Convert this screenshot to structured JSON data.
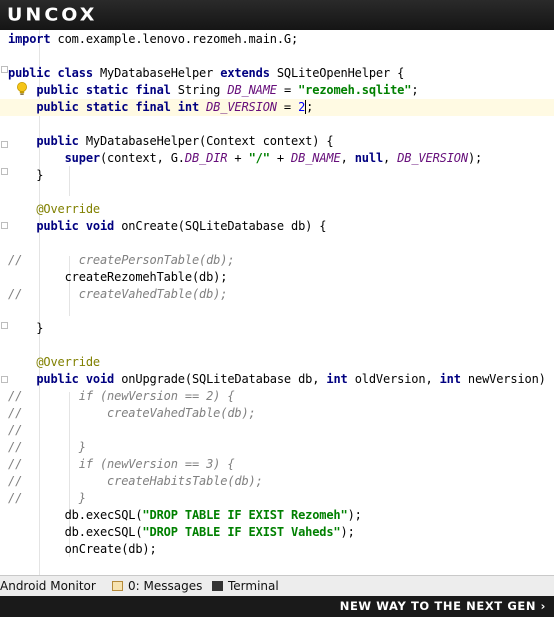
{
  "window": {
    "logo_text": "UNCOX",
    "tagline": "NEW WAY TO THE NEXT GEN ›"
  },
  "code": {
    "lines": [
      [
        [
          "kw",
          "import"
        ],
        [
          "t",
          " com.example.lenovo.rezomeh.main.G;"
        ]
      ],
      [],
      [
        [
          "kw",
          "public class"
        ],
        [
          "t",
          " MyDatabaseHelper "
        ],
        [
          "kw",
          "extends"
        ],
        [
          "t",
          " SQLiteOpenHelper {"
        ]
      ],
      [
        [
          "t",
          "    "
        ],
        [
          "kw",
          "public static final"
        ],
        [
          "t",
          " String "
        ],
        [
          "fld",
          "DB_NAME"
        ],
        [
          "t",
          " = "
        ],
        [
          "str",
          "\"rezomeh.sqlite\""
        ],
        [
          "t",
          ";"
        ]
      ],
      [
        [
          "t",
          "    "
        ],
        [
          "kw",
          "public static final int"
        ],
        [
          "t",
          " "
        ],
        [
          "fld",
          "DB_VERSION"
        ],
        [
          "t",
          " = "
        ],
        [
          "num",
          "2"
        ],
        [
          "cur",
          ""
        ],
        [
          "t",
          ";"
        ]
      ],
      [],
      [
        [
          "t",
          "    "
        ],
        [
          "kw",
          "public"
        ],
        [
          "t",
          " MyDatabaseHelper(Context context) {"
        ]
      ],
      [
        [
          "t",
          "        "
        ],
        [
          "kw",
          "super"
        ],
        [
          "t",
          "(context, G."
        ],
        [
          "fld",
          "DB_DIR"
        ],
        [
          "t",
          " + "
        ],
        [
          "str",
          "\"/\""
        ],
        [
          "t",
          " + "
        ],
        [
          "fld",
          "DB_NAME"
        ],
        [
          "t",
          ", "
        ],
        [
          "kw",
          "null"
        ],
        [
          "t",
          ", "
        ],
        [
          "fld",
          "DB_VERSION"
        ],
        [
          "t",
          ");"
        ]
      ],
      [
        [
          "t",
          "    }"
        ]
      ],
      [],
      [
        [
          "t",
          "    "
        ],
        [
          "ann",
          "@Override"
        ]
      ],
      [
        [
          "t",
          "    "
        ],
        [
          "kw",
          "public void"
        ],
        [
          "t",
          " onCreate(SQLiteDatabase db) {"
        ]
      ],
      [],
      [
        [
          "cmt",
          "//        createPersonTable(db);"
        ]
      ],
      [
        [
          "t",
          "        createRezomehTable(db);"
        ]
      ],
      [
        [
          "cmt",
          "//        createVahedTable(db);"
        ]
      ],
      [],
      [
        [
          "t",
          "    }"
        ]
      ],
      [],
      [
        [
          "t",
          "    "
        ],
        [
          "ann",
          "@Override"
        ]
      ],
      [
        [
          "t",
          "    "
        ],
        [
          "kw",
          "public void"
        ],
        [
          "t",
          " onUpgrade(SQLiteDatabase db, "
        ],
        [
          "kw",
          "int"
        ],
        [
          "t",
          " oldVersion, "
        ],
        [
          "kw",
          "int"
        ],
        [
          "t",
          " newVersion) {"
        ]
      ],
      [
        [
          "cmt",
          "//        if (newVersion == 2) {"
        ]
      ],
      [
        [
          "cmt",
          "//            createVahedTable(db);"
        ]
      ],
      [
        [
          "cmt",
          "//"
        ]
      ],
      [
        [
          "cmt",
          "//        }"
        ]
      ],
      [
        [
          "cmt",
          "//        if (newVersion == 3) {"
        ]
      ],
      [
        [
          "cmt",
          "//            createHabitsTable(db);"
        ]
      ],
      [
        [
          "cmt",
          "//        }"
        ]
      ],
      [
        [
          "t",
          "        db.execSQL("
        ],
        [
          "str",
          "\"DROP TABLE IF EXIST Rezomeh\""
        ],
        [
          "t",
          ");"
        ]
      ],
      [
        [
          "t",
          "        db.execSQL("
        ],
        [
          "str",
          "\"DROP TABLE IF EXIST Vaheds\""
        ],
        [
          "t",
          ");"
        ]
      ],
      [
        [
          "t",
          "        onCreate(db);"
        ]
      ]
    ],
    "current_line": 4
  },
  "statusbar": {
    "android_monitor": "Android Monitor",
    "messages": "0: Messages",
    "terminal": "Terminal"
  },
  "colors": {
    "keyword": "#000080",
    "field": "#660e7a",
    "string": "#008000",
    "number": "#0000ff",
    "annotation": "#808000",
    "comment": "#808080",
    "current_line_bg": "#fffae3"
  },
  "icons": [
    "lightbulb-icon",
    "messages-icon",
    "terminal-icon"
  ]
}
